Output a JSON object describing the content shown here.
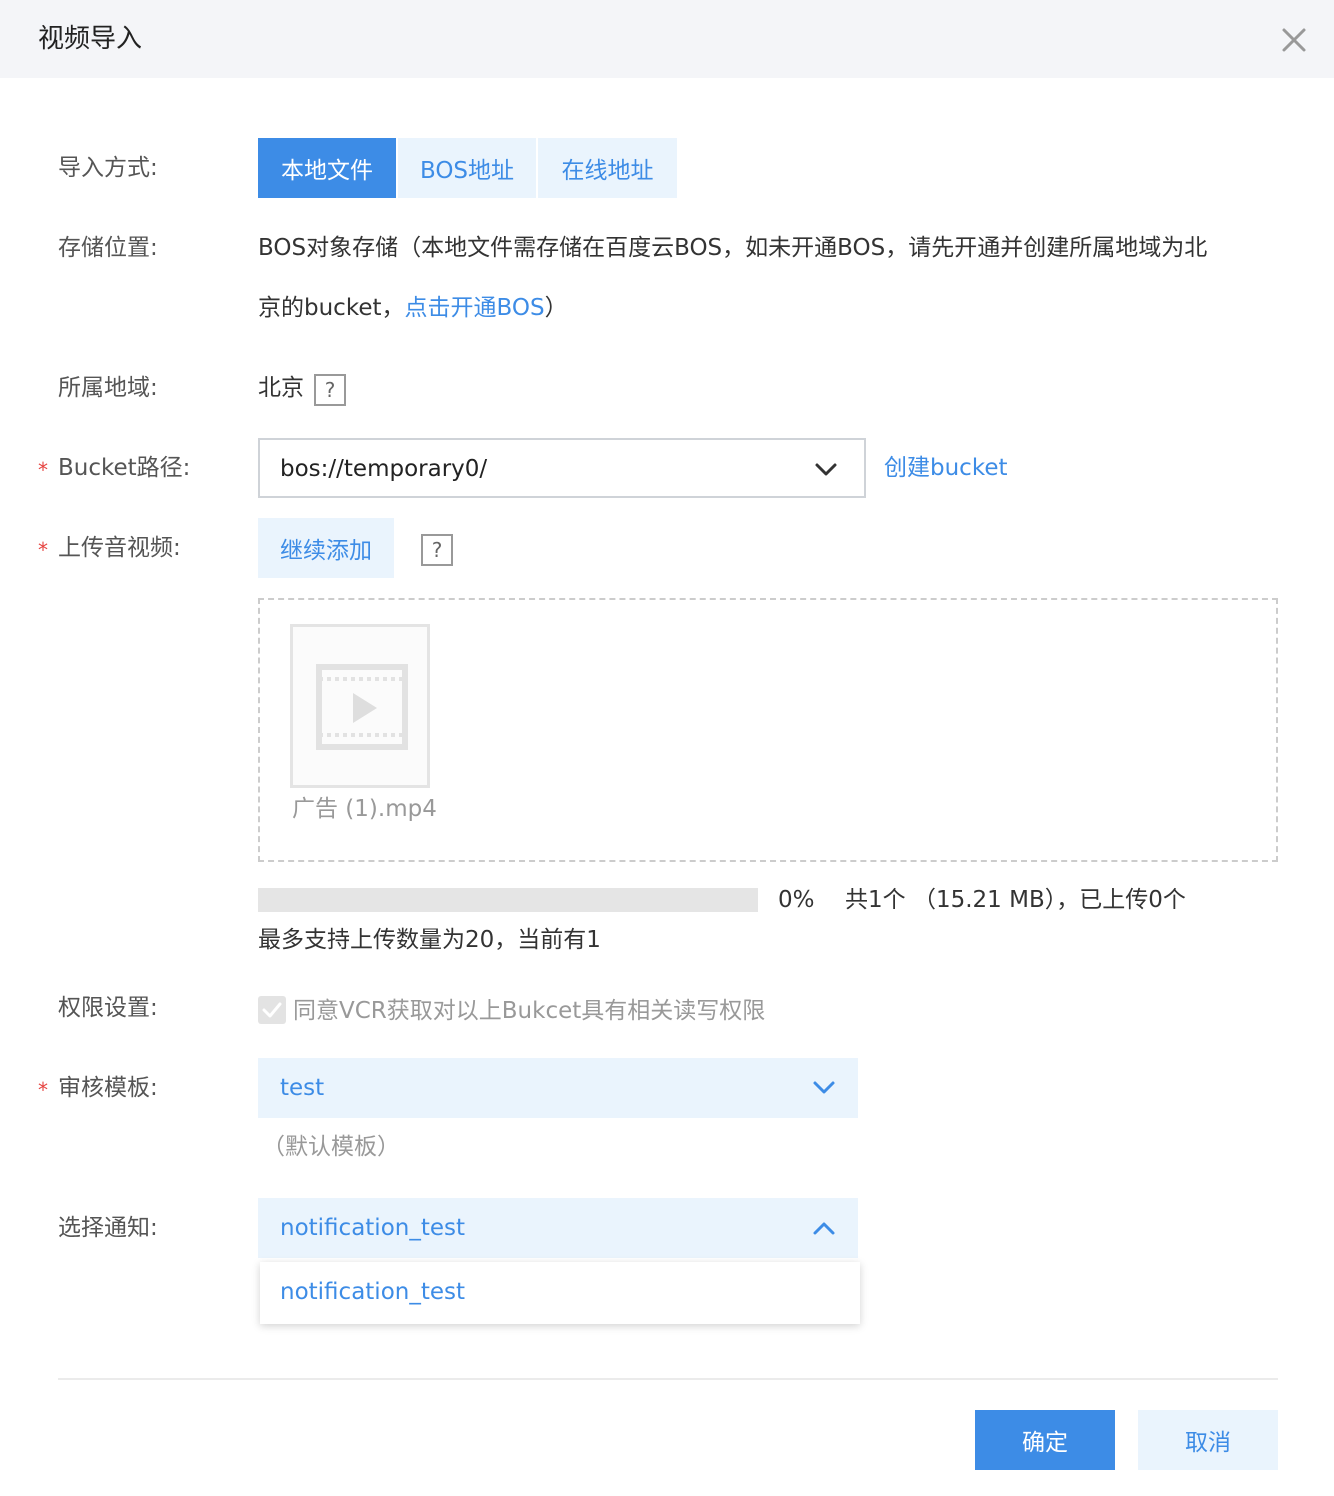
{
  "dialog": {
    "title": "视频导入"
  },
  "import_method": {
    "label": "导入方式:",
    "tabs": [
      {
        "label": "本地文件",
        "active": true
      },
      {
        "label": "BOS地址",
        "active": false
      },
      {
        "label": "在线地址",
        "active": false
      }
    ]
  },
  "storage": {
    "label": "存储位置:",
    "line1": "BOS对象存储（本地文件需存储在百度云BOS，如未开通BOS，请先开通并创建所属地域为北",
    "line2_prefix": "京的bucket，",
    "link": "点击开通BOS",
    "line2_suffix": "）"
  },
  "region": {
    "label": "所属地域:",
    "value": "北京",
    "help": "?"
  },
  "bucket": {
    "required_mark": "*",
    "label": "Bucket路径:",
    "value": "bos://temporary0/",
    "create_link": "创建bucket"
  },
  "upload": {
    "required_mark": "*",
    "label": "上传音视频:",
    "add_button": "继续添加",
    "help": "?",
    "file_name": "广告 (1).mp4",
    "progress_value": 0,
    "percent_text": "0%",
    "summary_text": "共1个 （15.21 MB），已上传0个",
    "limit_text": "最多支持上传数量为20，当前有1"
  },
  "permission": {
    "label": "权限设置:",
    "checkbox_text": "同意VCR获取对以上Bukcet具有相关读写权限",
    "checked": true
  },
  "audit_template": {
    "required_mark": "*",
    "label": "审核模板:",
    "value": "test",
    "note": "（默认模板）"
  },
  "notification": {
    "label": "选择通知:",
    "value": "notification_test",
    "options": [
      "notification_test"
    ]
  },
  "footer": {
    "ok": "确定",
    "cancel": "取消"
  },
  "colors": {
    "accent": "#3d8ce6",
    "accent_light": "#eaf4fd",
    "required": "#e64340"
  }
}
